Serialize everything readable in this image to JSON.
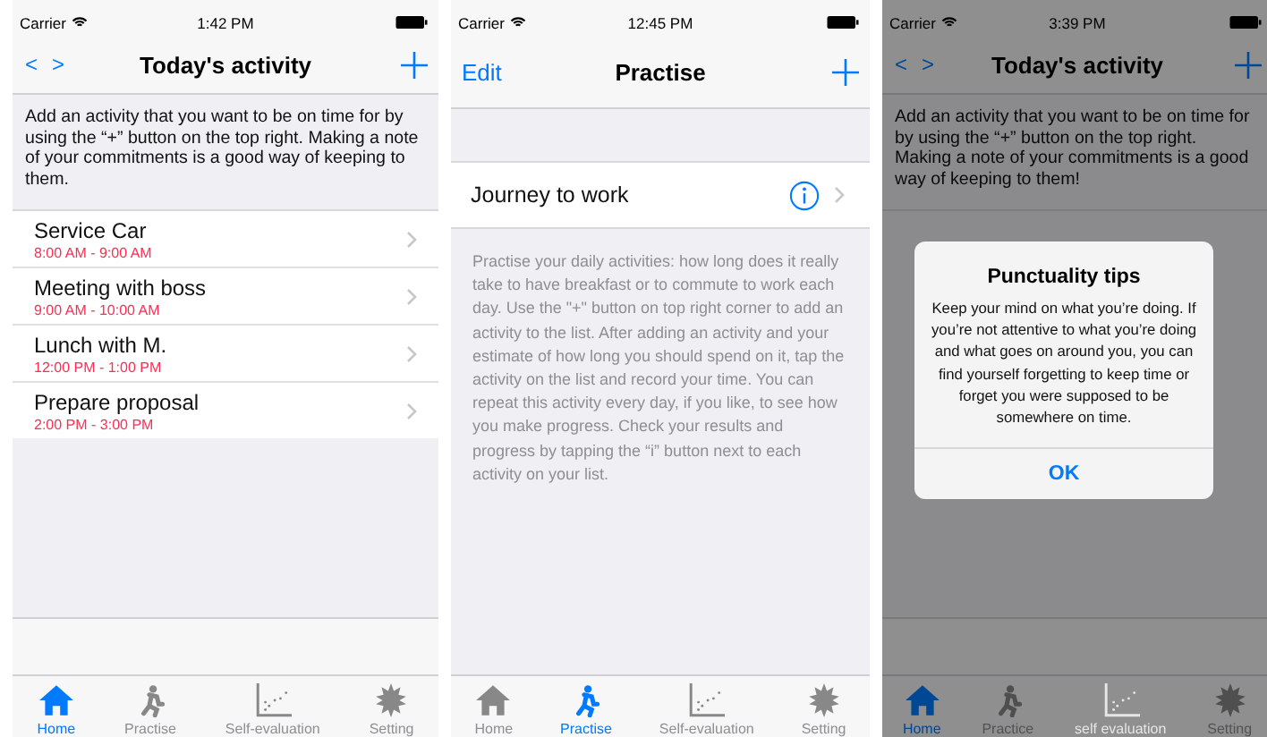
{
  "screens": [
    {
      "kind": "activities",
      "dimmed": false,
      "status_bar": {
        "carrier": "Carrier",
        "time": "1:42 PM"
      },
      "nav_bar": {
        "left": [
          {
            "kind": "arrow",
            "label": "<"
          },
          {
            "kind": "arrow",
            "label": ">"
          }
        ],
        "title": "Today's activity"
      },
      "intro": "Add an activity that you want to be on time for by using the “+” button on the top right. Making a note of your commitments is a good way of keeping to them.",
      "activities": [
        {
          "name": "Service Car",
          "time": "8:00 AM - 9:00 AM"
        },
        {
          "name": "Meeting with boss",
          "time": "9:00 AM - 10:00 AM"
        },
        {
          "name": "Lunch with M.",
          "time": "12:00 PM - 1:00 PM"
        },
        {
          "name": "Prepare proposal",
          "time": "2:00 PM - 3:00 PM"
        }
      ],
      "tabs": [
        {
          "label": "Home",
          "selected": true
        },
        {
          "label": "Practise",
          "selected": false
        },
        {
          "label": "Self-evaluation",
          "selected": false
        },
        {
          "label": "Setting",
          "selected": false
        }
      ]
    },
    {
      "kind": "practice",
      "dimmed": false,
      "status_bar": {
        "carrier": "Carrier",
        "time": "12:45 PM"
      },
      "nav_bar": {
        "left": [
          {
            "kind": "text",
            "label": "Edit"
          }
        ],
        "title": "Practise"
      },
      "rows": [
        {
          "name": "Journey to work"
        }
      ],
      "description": "Practise your daily activities: how long does it really take to have breakfast or to commute to work each day. Use the \"+\" button on top right corner to add an activity to the list. After adding an activity and your estimate of how long you should spend on it, tap the activity on the list and record your time. You can repeat this activity every day, if you like, to see how you make progress. Check your results and progress by tapping the “i” button next to each activity on your list.",
      "tabs": [
        {
          "label": "Home",
          "selected": false
        },
        {
          "label": "Practise",
          "selected": true
        },
        {
          "label": "Self-evaluation",
          "selected": false
        },
        {
          "label": "Setting",
          "selected": false
        }
      ]
    },
    {
      "kind": "activities",
      "dimmed": true,
      "status_bar": {
        "carrier": "Carrier",
        "time": "3:39 PM"
      },
      "nav_bar": {
        "left": [
          {
            "kind": "arrow",
            "label": "<"
          },
          {
            "kind": "arrow",
            "label": ">"
          }
        ],
        "title": "Today's activity"
      },
      "intro": "Add an activity that you want to be on time for by using the “+” button on the top right. Making a note of your commitments is a good way of keeping to them!",
      "alert": {
        "title": "Punctuality tips",
        "message": "Keep your mind on what you’re doing. If you’re not attentive to what you’re doing and what goes on around you, you can find yourself forgetting to keep time or forget you were supposed to be somewhere on time.",
        "button": "OK"
      },
      "tabs": [
        {
          "label": "Home",
          "selected": true,
          "disabled": false
        },
        {
          "label": "Practice",
          "selected": false,
          "disabled": false
        },
        {
          "label": "self evaluation",
          "selected": false,
          "disabled": true
        },
        {
          "label": "Setting",
          "selected": false,
          "disabled": false
        }
      ]
    }
  ]
}
